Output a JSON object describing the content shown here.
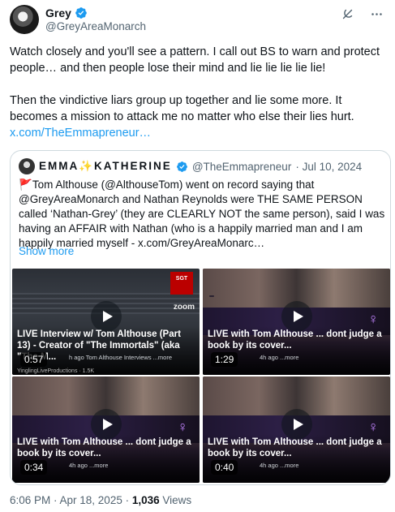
{
  "author": {
    "display_name": "Grey",
    "handle": "@GreyAreaMonarch",
    "verified_color": "#1d9bf0"
  },
  "header_icons": [
    "grok-icon",
    "more-icon"
  ],
  "tweet": {
    "paragraph1": "Watch closely and you'll see a pattern. I call out BS to warn and protect people… and then people lose their mind and lie lie lie lie lie!",
    "paragraph2": "Then the vindictive liars group up together and lie some more. It becomes a mission to attack me no matter who else their lies hurt.",
    "link": "x.com/TheEmmapreneur…"
  },
  "quote": {
    "display_name": "EMMA✨KATHERINE",
    "handle": "@TheEmmapreneur",
    "date": "· Jul 10, 2024",
    "text": "Tom Althouse (@AlthouseTom) went on record saying that @GreyAreaMonarch and Nathan Reynolds were THE SAME PERSON called ‘Nathan-Grey’ (they are CLEARLY NOT the same person), said I was having an AFFAIR with Nathan (who is a happily married man and I am happily married myself -  x.com/GreyAreaMonarc…",
    "show_more": "Show more",
    "videos": [
      {
        "title": "LIVE Interview w/ Tom Althouse (Part 13) - Creator of \"The Immortals\" (aka \"The M...",
        "sub": "h ago  Tom Althouse Interviews  ...more",
        "duration": "0:57",
        "extra": "YinglingLiveProductions · 1.5K"
      },
      {
        "title": "LIVE with Tom Althouse ... dont judge a book by its cover...",
        "sub": "4h ago  ...more",
        "duration": "1:29"
      },
      {
        "title": "LIVE with Tom Althouse ... dont judge a book by its cover...",
        "sub": "4h ago  ...more",
        "duration": "0:34"
      },
      {
        "title": "LIVE with Tom Althouse ... dont judge a book by its cover...",
        "sub": "4h ago  ...more",
        "duration": "0:40"
      }
    ]
  },
  "footer": {
    "timestamp": "6:06 PM · Apr 18, 2025 · ",
    "views_count": "1,036",
    "views_label": " Views"
  },
  "colors": {
    "link": "#1d9bf0",
    "secondary_text": "#536471",
    "border": "#cfd9de"
  }
}
